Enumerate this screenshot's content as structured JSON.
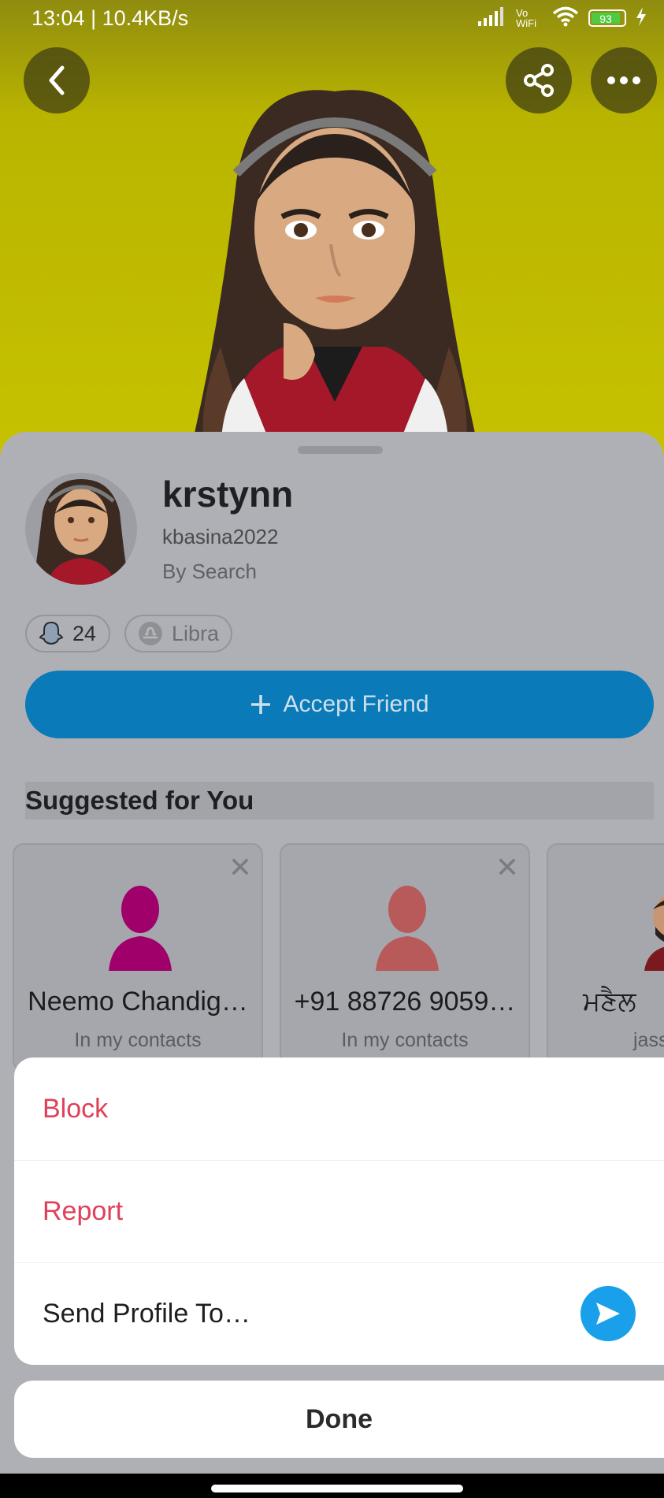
{
  "status_bar": {
    "time": "13:04 | 10.4KB/s",
    "network": "Vo WiFi",
    "battery": "93"
  },
  "profile": {
    "display_name": "krstynn",
    "username": "kbasina2022",
    "source": "By Search",
    "snapscore": "24",
    "zodiac": "Libra"
  },
  "actions": {
    "accept_label": "Accept Friend"
  },
  "suggested": {
    "title": "Suggested for You",
    "cards": [
      {
        "name": "Neemo Chandig…",
        "sub": "In my contacts",
        "color": "#a0006a"
      },
      {
        "name": "+91 88726 9059…",
        "sub": "In my contacts",
        "color": "#b85a5a"
      },
      {
        "name": "ਮਣੈਲ",
        "sub": "jass"
      }
    ]
  },
  "menu": {
    "block": "Block",
    "report": "Report",
    "send_profile": "Send Profile To…",
    "done": "Done"
  },
  "colors": {
    "accent_blue": "#0a7ab8",
    "danger": "#e0405a",
    "hero_yellow": "#c6c200"
  }
}
